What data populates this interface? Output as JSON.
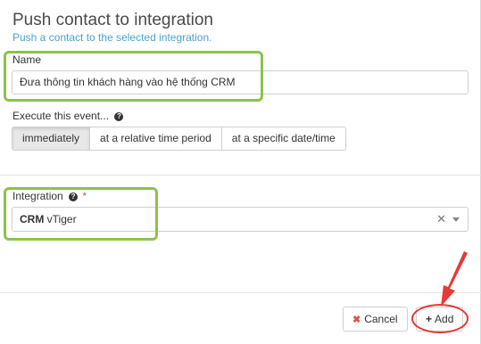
{
  "dialog": {
    "title": "Push contact to integration",
    "subtitle": "Push a contact to the selected integration."
  },
  "name_field": {
    "label": "Name",
    "value": "Đưa thông tin khách hàng vào hệ thống CRM"
  },
  "execute": {
    "label": "Execute this event...",
    "options": [
      "immediately",
      "at a relative time period",
      "at a specific date/time"
    ],
    "selected": "immediately"
  },
  "integration": {
    "label": "Integration",
    "required_mark": "*",
    "value_bold": "CRM",
    "value_rest": "vTiger"
  },
  "footer": {
    "cancel_label": "Cancel",
    "add_label": "Add"
  },
  "colors": {
    "highlight_green": "#8bc34a",
    "annotation_red": "#e53935",
    "subtitle_blue": "#4aa3c9"
  }
}
